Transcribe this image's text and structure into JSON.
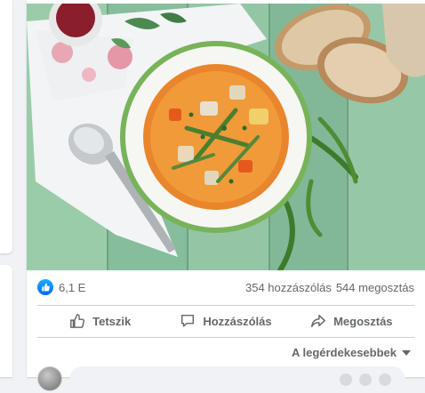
{
  "post": {
    "image_alt": "Leves zöldségekkel, tálban, kenyérrel és kanállal",
    "reactions": {
      "icon": "like-icon",
      "count": "6,1 E"
    },
    "comments_count": "354 hozzászólás",
    "shares_count": "544 megosztás",
    "actions": {
      "like": {
        "label": "Tetszik",
        "icon": "thumbs-up-icon"
      },
      "comment": {
        "label": "Hozzászólás",
        "icon": "comment-icon"
      },
      "share": {
        "label": "Megosztás",
        "icon": "share-icon"
      }
    },
    "sort_label": "A legérdekesebbek",
    "colors": {
      "accent": "#0866ff",
      "text_secondary": "#65676b",
      "background": "#f0f2f5"
    }
  }
}
